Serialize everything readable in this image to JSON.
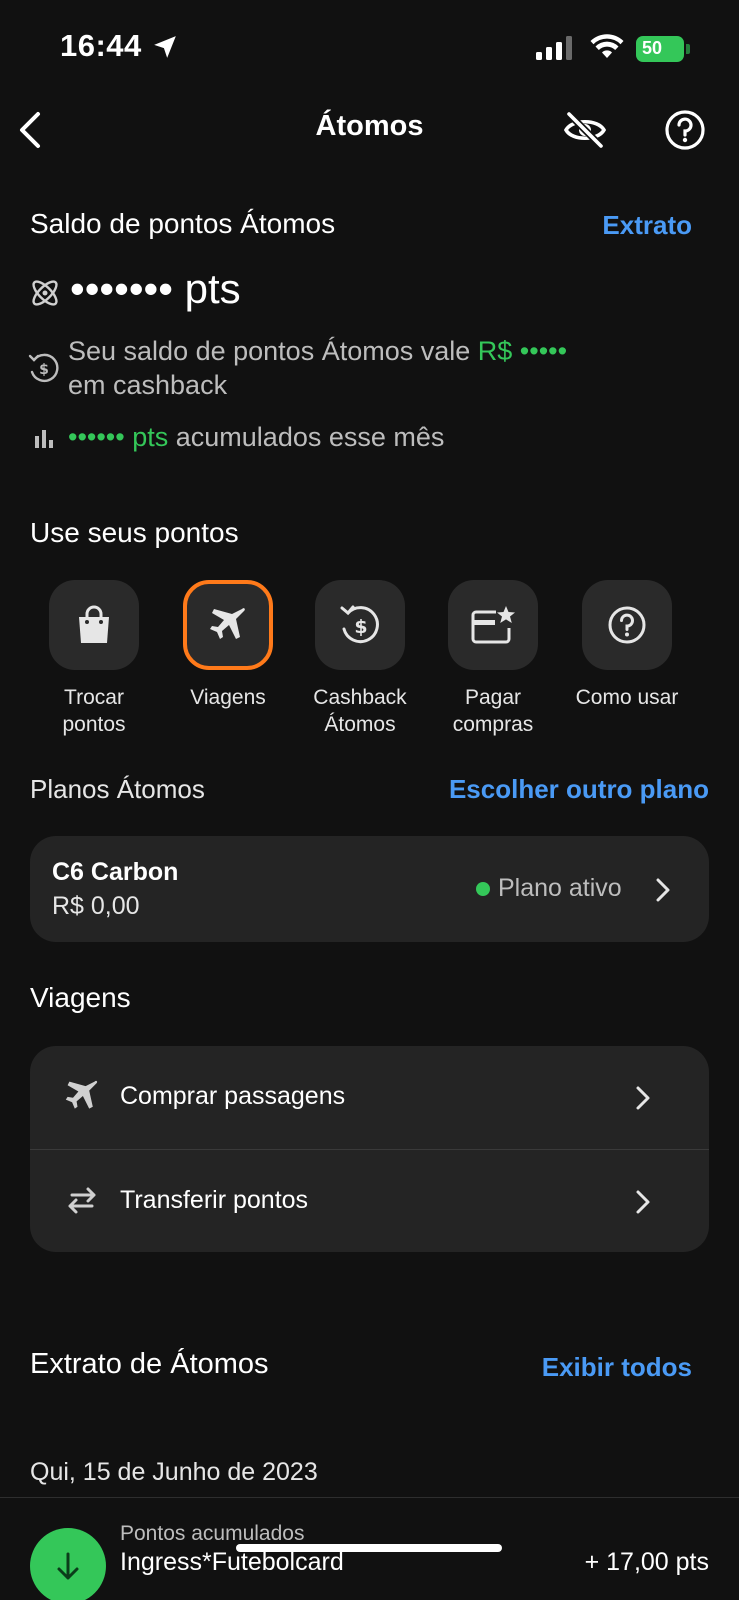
{
  "status_bar": {
    "time": "16:44",
    "battery": "50"
  },
  "nav": {
    "title": "Átomos"
  },
  "saldo": {
    "title": "Saldo de pontos Átomos",
    "extrato_link": "Extrato",
    "balance_masked": "•••••••",
    "balance_unit": "pts",
    "cashback_prefix": "Seu saldo de pontos Átomos vale",
    "cashback_value": "R$ •••••",
    "cashback_suffix": "em cashback",
    "accumulated_value": "•••••• pts",
    "accumulated_suffix": "acumulados esse mês"
  },
  "use_points": {
    "title": "Use seus pontos",
    "actions": [
      {
        "line1": "Trocar",
        "line2": "pontos",
        "icon": "shopping-bag-icon"
      },
      {
        "line1": "Viagens",
        "line2": "",
        "icon": "airplane-icon"
      },
      {
        "line1": "Cashback",
        "line2": "Átomos",
        "icon": "cashback-icon"
      },
      {
        "line1": "Pagar",
        "line2": "compras",
        "icon": "card-star-icon"
      },
      {
        "line1": "Como usar",
        "line2": "",
        "icon": "question-icon"
      }
    ]
  },
  "plans": {
    "title": "Planos Átomos",
    "choose_link": "Escolher outro plano",
    "current": {
      "name": "C6 Carbon",
      "price": "R$ 0,00",
      "status": "Plano ativo"
    }
  },
  "travel": {
    "title": "Viagens",
    "items": [
      {
        "label": "Comprar passagens",
        "icon": "airplane-icon"
      },
      {
        "label": "Transferir pontos",
        "icon": "transfer-arrows-icon"
      }
    ]
  },
  "statement": {
    "title": "Extrato de Átomos",
    "show_all_link": "Exibir todos",
    "date": "Qui, 15 de Junho de 2023",
    "transactions": [
      {
        "subtitle": "Pontos acumulados",
        "title": "Ingress*Futebolcard",
        "amount": "+ 17,00 pts"
      }
    ]
  },
  "colors": {
    "background": "#111111",
    "accent_link": "#4a9af5",
    "positive": "#34c759",
    "highlight": "#ff7a1a"
  }
}
